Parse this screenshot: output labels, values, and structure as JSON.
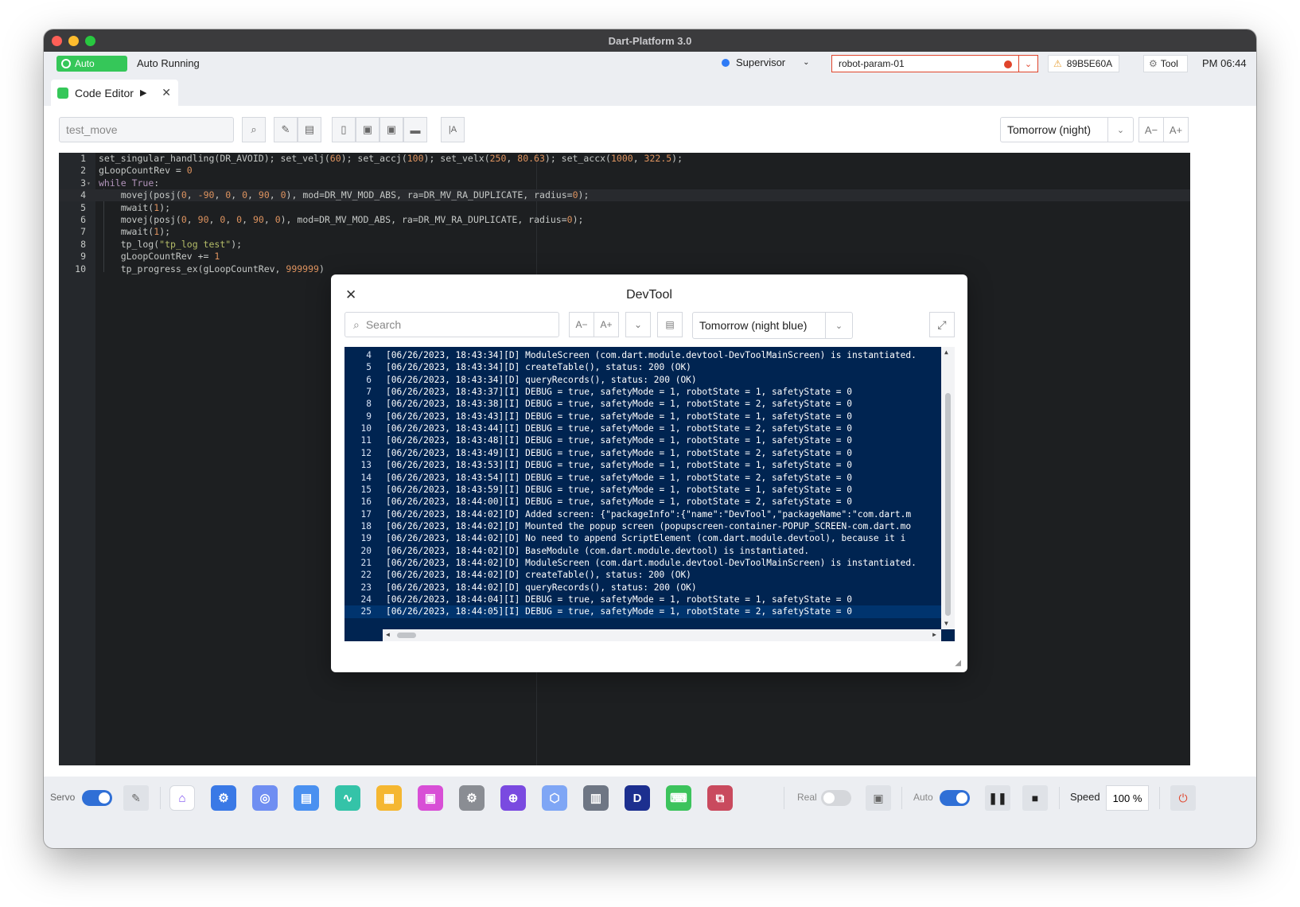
{
  "window": {
    "title": "Dart-Platform 3.0"
  },
  "status": {
    "mode": "Auto",
    "state": "Auto Running",
    "user": "Supervisor",
    "robot_param": "robot-param-01",
    "serial": "89B5E60A",
    "tool_label": "Tool",
    "time": "PM 06:44"
  },
  "tab": {
    "label": "Code Editor"
  },
  "editor": {
    "filename": "test_move",
    "theme": "Tomorrow (night)",
    "font_dec": "A−",
    "font_inc": "A+",
    "lines": [
      "set_singular_handling(DR_AVOID); set_velj(60); set_accj(100); set_velx(250, 80.63); set_accx(1000, 322.5);",
      "gLoopCountRev = 0",
      "while True:",
      "    movej(posj(0, -90, 0, 0, 90, 0), mod=DR_MV_MOD_ABS, ra=DR_MV_RA_DUPLICATE, radius=0);",
      "    mwait(1);",
      "    movej(posj(0, 90, 0, 0, 90, 0), mod=DR_MV_MOD_ABS, ra=DR_MV_RA_DUPLICATE, radius=0);",
      "    mwait(1);",
      "    tp_log(\"tp_log test\");",
      "    gLoopCountRev += 1",
      "    tp_progress_ex(gLoopCountRev, 999999)"
    ]
  },
  "devtool": {
    "title": "DevTool",
    "search_placeholder": "Search",
    "font_dec": "A−",
    "font_inc": "A+",
    "theme": "Tomorrow (night blue)",
    "first_line": 4,
    "logs": [
      "[06/26/2023, 18:43:34][D] ModuleScreen (com.dart.module.devtool-DevToolMainScreen) is instantiated.",
      "[06/26/2023, 18:43:34][D] createTable(), status: 200 (OK)",
      "[06/26/2023, 18:43:34][D] queryRecords(), status: 200 (OK)",
      "[06/26/2023, 18:43:37][I] DEBUG = true, safetyMode = 1, robotState = 1, safetyState = 0",
      "[06/26/2023, 18:43:38][I] DEBUG = true, safetyMode = 1, robotState = 2, safetyState = 0",
      "[06/26/2023, 18:43:43][I] DEBUG = true, safetyMode = 1, robotState = 1, safetyState = 0",
      "[06/26/2023, 18:43:44][I] DEBUG = true, safetyMode = 1, robotState = 2, safetyState = 0",
      "[06/26/2023, 18:43:48][I] DEBUG = true, safetyMode = 1, robotState = 1, safetyState = 0",
      "[06/26/2023, 18:43:49][I] DEBUG = true, safetyMode = 1, robotState = 2, safetyState = 0",
      "[06/26/2023, 18:43:53][I] DEBUG = true, safetyMode = 1, robotState = 1, safetyState = 0",
      "[06/26/2023, 18:43:54][I] DEBUG = true, safetyMode = 1, robotState = 2, safetyState = 0",
      "[06/26/2023, 18:43:59][I] DEBUG = true, safetyMode = 1, robotState = 1, safetyState = 0",
      "[06/26/2023, 18:44:00][I] DEBUG = true, safetyMode = 1, robotState = 2, safetyState = 0",
      "[06/26/2023, 18:44:02][D] Added screen: {\"packageInfo\":{\"name\":\"DevTool\",\"packageName\":\"com.dart.m",
      "[06/26/2023, 18:44:02][D] Mounted the popup screen (popupscreen-container-POPUP_SCREEN-com.dart.mo",
      "[06/26/2023, 18:44:02][D] No need to append ScriptElement (com.dart.module.devtool), because it i",
      "[06/26/2023, 18:44:02][D] BaseModule (com.dart.module.devtool) is instantiated.",
      "[06/26/2023, 18:44:02][D] ModuleScreen (com.dart.module.devtool-DevToolMainScreen) is instantiated.",
      "[06/26/2023, 18:44:02][D] createTable(), status: 200 (OK)",
      "[06/26/2023, 18:44:02][D] queryRecords(), status: 200 (OK)",
      "[06/26/2023, 18:44:04][I] DEBUG = true, safetyMode = 1, robotState = 1, safetyState = 0",
      "[06/26/2023, 18:44:05][I] DEBUG = true, safetyMode = 1, robotState = 2, safetyState = 0"
    ]
  },
  "dock": {
    "servo_label": "Servo",
    "real_label": "Real",
    "auto_label": "Auto",
    "speed_label": "Speed",
    "speed_value": "100 %",
    "apps": [
      {
        "name": "home-app-icon",
        "color": "#ffffff",
        "glyph": "⌂",
        "fg": "#7b4cf0"
      },
      {
        "name": "robot-arm-app-icon",
        "color": "#3a79e6",
        "glyph": "⚙",
        "fg": "#ffffff"
      },
      {
        "name": "wireless-app-icon",
        "color": "#6f8ef2",
        "glyph": "◎",
        "fg": "#ffffff"
      },
      {
        "name": "document-app-icon",
        "color": "#4a90f0",
        "glyph": "▤",
        "fg": "#ffffff"
      },
      {
        "name": "monitor-app-icon",
        "color": "#34c3a8",
        "glyph": "∿",
        "fg": "#ffffff"
      },
      {
        "name": "notes-app-icon",
        "color": "#f5b731",
        "glyph": "▦",
        "fg": "#ffffff"
      },
      {
        "name": "store-app-icon",
        "color": "#d84fd6",
        "glyph": "▣",
        "fg": "#ffffff"
      },
      {
        "name": "settings-app-icon",
        "color": "#8a8d93",
        "glyph": "⚙",
        "fg": "#ffffff"
      },
      {
        "name": "joystick-app-icon",
        "color": "#7a4ae0",
        "glyph": "⊕",
        "fg": "#ffffff"
      },
      {
        "name": "cube-app-icon",
        "color": "#7fa6f5",
        "glyph": "⬡",
        "fg": "#ffffff"
      },
      {
        "name": "toolbox-app-icon",
        "color": "#6e7684",
        "glyph": "▥",
        "fg": "#ffffff"
      },
      {
        "name": "dart-app-icon",
        "color": "#1c2f8f",
        "glyph": "D",
        "fg": "#ffffff"
      },
      {
        "name": "code-editor-app-icon",
        "color": "#3cc35c",
        "glyph": "⌨",
        "fg": "#ffffff"
      },
      {
        "name": "devtool-app-icon",
        "color": "#c94a5e",
        "glyph": "⧉",
        "fg": "#ffffff"
      }
    ]
  }
}
